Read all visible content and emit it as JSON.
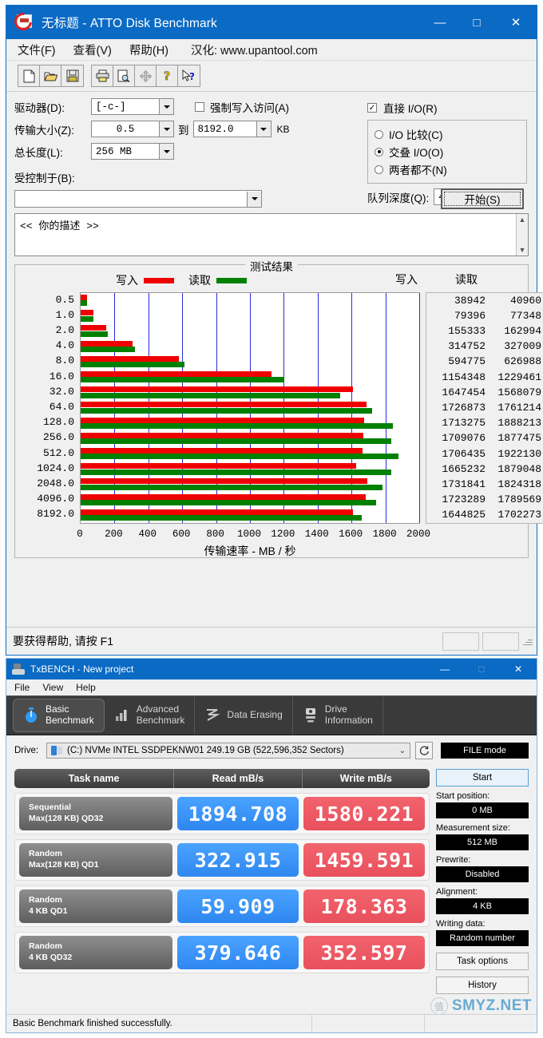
{
  "atto": {
    "title": "无标题 - ATTO Disk Benchmark",
    "window_buttons": {
      "minimize": "—",
      "maximize": "□",
      "close": "✕"
    },
    "menu": {
      "file": "文件(F)",
      "view": "查看(V)",
      "help": "帮助(H)",
      "localization": "汉化: www.upantool.com"
    },
    "toolbar_icons": [
      "new-file-icon",
      "open-folder-icon",
      "save-disk-icon",
      "print-icon",
      "print-preview-icon",
      "move-icon",
      "help-question-icon",
      "help-pointer-icon"
    ],
    "controls": {
      "drive_label": "驱动器(D):",
      "drive_value": "[-c-]",
      "force_write_label": "强制写入访问(A)",
      "force_write_checked": false,
      "direct_io_label": "直接 I/O(R)",
      "direct_io_checked": true,
      "transfer_size_label": "传输大小(Z):",
      "transfer_size_from": "0.5",
      "transfer_size_to_label": "到",
      "transfer_size_to": "8192.0",
      "transfer_size_unit": "KB",
      "total_length_label": "总长度(L):",
      "total_length_value": "256 MB",
      "io_mode_options": [
        "I/O 比较(C)",
        "交叠 I/O(O)",
        "两者都不(N)"
      ],
      "io_mode_selected_index": 1,
      "queue_depth_label": "队列深度(Q):",
      "queue_depth_value": "4",
      "controlled_by_label": "受控制于(B):",
      "controlled_by_value": "",
      "start_button": "开始(S)",
      "description_value": "<<  你的描述   >>"
    },
    "status": "要获得帮助, 请按 F1"
  },
  "chart_data": {
    "type": "bar",
    "title": "测试结果",
    "xlabel": "传输速率 - MB / 秒",
    "ylabel": "",
    "categories": [
      "0.5",
      "1.0",
      "2.0",
      "4.0",
      "8.0",
      "16.0",
      "32.0",
      "64.0",
      "128.0",
      "256.0",
      "512.0",
      "1024.0",
      "2048.0",
      "4096.0",
      "8192.0"
    ],
    "series": [
      {
        "name": "写入",
        "color": "#ee0000",
        "values_kbps": [
          38942,
          79396,
          155333,
          314752,
          594775,
          1154348,
          1647454,
          1726873,
          1713275,
          1709076,
          1706435,
          1665232,
          1731841,
          1723289,
          1644825
        ],
        "values_mbps": [
          38.0,
          77.5,
          151.7,
          307.4,
          580.8,
          1127.3,
          1608.8,
          1686.4,
          1673.1,
          1669.0,
          1666.4,
          1626.2,
          1691.3,
          1682.9,
          1606.3
        ]
      },
      {
        "name": "读取",
        "color": "#008000",
        "values_kbps": [
          40960,
          77348,
          162994,
          327009,
          626988,
          1229461,
          1568079,
          1761214,
          1888213,
          1877475,
          1922130,
          1879048,
          1824318,
          1789569,
          1702273
        ],
        "values_mbps": [
          40.0,
          75.5,
          159.2,
          319.3,
          612.3,
          1200.6,
          1531.3,
          1719.9,
          1843.9,
          1833.5,
          1877.1,
          1835.0,
          1781.6,
          1747.6,
          1662.4
        ]
      }
    ],
    "xticks": [
      0,
      200,
      400,
      600,
      800,
      1000,
      1200,
      1400,
      1600,
      1800,
      2000
    ],
    "xlim": [
      0,
      2000
    ],
    "grid": true,
    "legend_position": "top",
    "value_column_headers": [
      "写入",
      "读取"
    ]
  },
  "txbench": {
    "title": "TxBENCH - New project",
    "window_buttons": {
      "minimize": "—",
      "maximize": "□",
      "close": "✕"
    },
    "menu": [
      "File",
      "View",
      "Help"
    ],
    "tabs": [
      {
        "label_line1": "Basic",
        "label_line2": "Benchmark",
        "icon": "stopwatch-icon",
        "active": true
      },
      {
        "label_line1": "Advanced",
        "label_line2": "Benchmark",
        "icon": "bar-chart-icon",
        "active": false
      },
      {
        "label_line1": "Data Erasing",
        "label_line2": "",
        "icon": "erase-icon",
        "active": false
      },
      {
        "label_line1": "Drive",
        "label_line2": "Information",
        "icon": "drive-info-icon",
        "active": false
      }
    ],
    "drive_label": "Drive:",
    "drive_value": "(C:) NVMe INTEL SSDPEKNW01  249.19 GB (522,596,352 Sectors)",
    "refresh_icon": "refresh-icon",
    "file_mode": "FILE mode",
    "table_headers": [
      "Task name",
      "Read mB/s",
      "Write mB/s"
    ],
    "rows": [
      {
        "name_line1": "Sequential",
        "name_line2": "Max(128 KB) QD32",
        "read": "1894.708",
        "write": "1580.221"
      },
      {
        "name_line1": "Random",
        "name_line2": "Max(128 KB) QD1",
        "read": "322.915",
        "write": "1459.591"
      },
      {
        "name_line1": "Random",
        "name_line2": "4 KB QD1",
        "read": "59.909",
        "write": "178.363"
      },
      {
        "name_line1": "Random",
        "name_line2": "4 KB QD32",
        "read": "379.646",
        "write": "352.597"
      }
    ],
    "sidebar": {
      "start_button": "Start",
      "fields": [
        {
          "label": "Start position:",
          "value": "0 MB"
        },
        {
          "label": "Measurement size:",
          "value": "512 MB"
        },
        {
          "label": "Prewrite:",
          "value": "Disabled"
        },
        {
          "label": "Alignment:",
          "value": "4 KB"
        },
        {
          "label": "Writing data:",
          "value": "Random number"
        }
      ],
      "task_options_button": "Task options",
      "history_button": "History"
    },
    "status": "Basic Benchmark finished successfully."
  },
  "watermark": {
    "mark": "值",
    "text": "SMYZ.NET"
  },
  "colors": {
    "titlebar": "#0a6ac4",
    "write_bar": "#ee0000",
    "read_bar": "#008000",
    "read_tile": "#2e87ef",
    "write_tile": "#e8505c",
    "gridline": "#2b2bdd"
  }
}
